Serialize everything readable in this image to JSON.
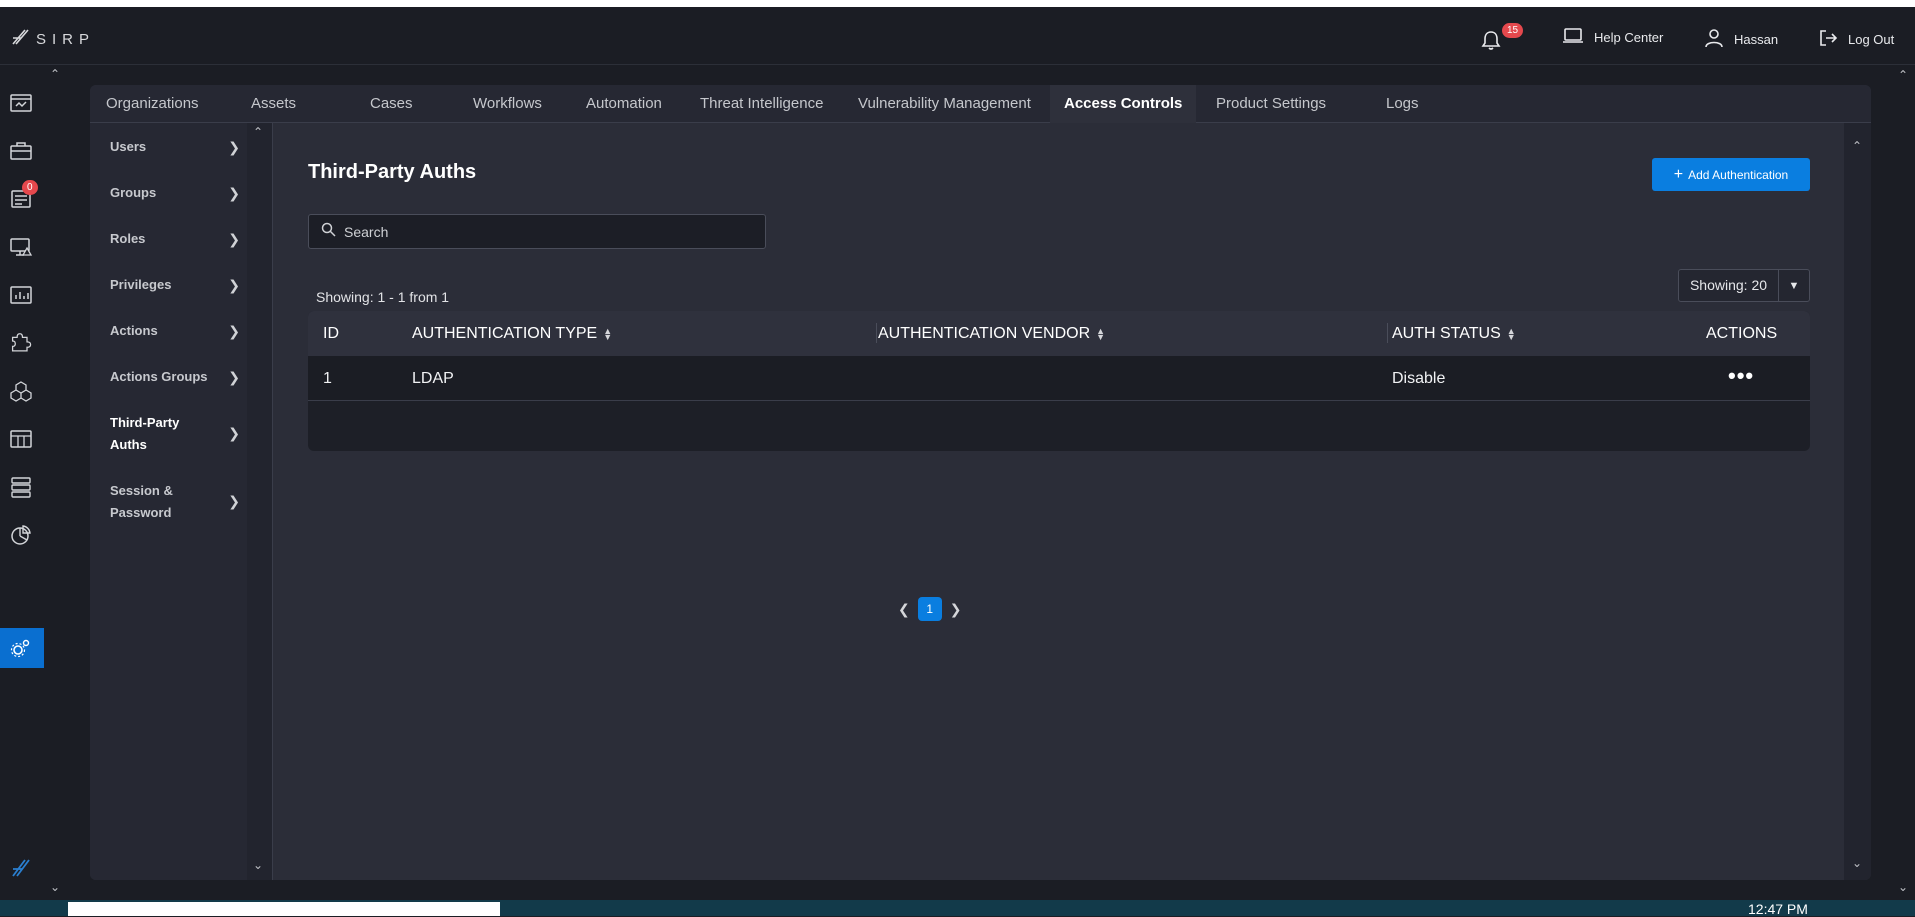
{
  "header": {
    "logo_text": "SIRP",
    "notification_count": "15",
    "help_center": "Help Center",
    "user_name": "Hassan",
    "logout": "Log Out"
  },
  "iconbar": {
    "alerts_badge": "0",
    "icons": [
      "dashboard-icon",
      "briefcase-icon",
      "reports-icon",
      "monitor-alert-icon",
      "analytics-icon",
      "puzzle-icon",
      "cubes-icon",
      "grid-calendar-icon",
      "database-icon",
      "pie-chart-icon",
      "settings-gears-icon"
    ]
  },
  "tabs": [
    {
      "label": "Organizations"
    },
    {
      "label": "Assets"
    },
    {
      "label": "Cases"
    },
    {
      "label": "Workflows"
    },
    {
      "label": "Automation"
    },
    {
      "label": "Threat Intelligence"
    },
    {
      "label": "Vulnerability Management"
    },
    {
      "label": "Access Controls"
    },
    {
      "label": "Product Settings"
    },
    {
      "label": "Logs"
    }
  ],
  "subnav": [
    {
      "label": "Users"
    },
    {
      "label": "Groups"
    },
    {
      "label": "Roles"
    },
    {
      "label": "Privileges"
    },
    {
      "label": "Actions"
    },
    {
      "label": "Actions Groups"
    },
    {
      "label": "Third-Party Auths"
    },
    {
      "label": "Session & Password"
    }
  ],
  "main": {
    "title": "Third-Party Auths",
    "add_button": "Add Authentication",
    "search_placeholder": "Search",
    "showing_text": "Showing: 1 - 1 from 1",
    "page_size_label": "Showing: 20"
  },
  "table": {
    "columns": [
      "ID",
      "AUTHENTICATION TYPE",
      "AUTHENTICATION VENDOR",
      "AUTH STATUS",
      "ACTIONS"
    ],
    "rows": [
      {
        "id": "1",
        "type": "LDAP",
        "vendor": "",
        "status": "Disable"
      }
    ]
  },
  "pagination": {
    "current_page": "1"
  },
  "taskbar": {
    "clock": "12:47 PM"
  },
  "colors": {
    "accent": "#0a7ee0",
    "badge": "#e5484d",
    "background": "#1b1d24",
    "panel": "#2b2d38"
  }
}
